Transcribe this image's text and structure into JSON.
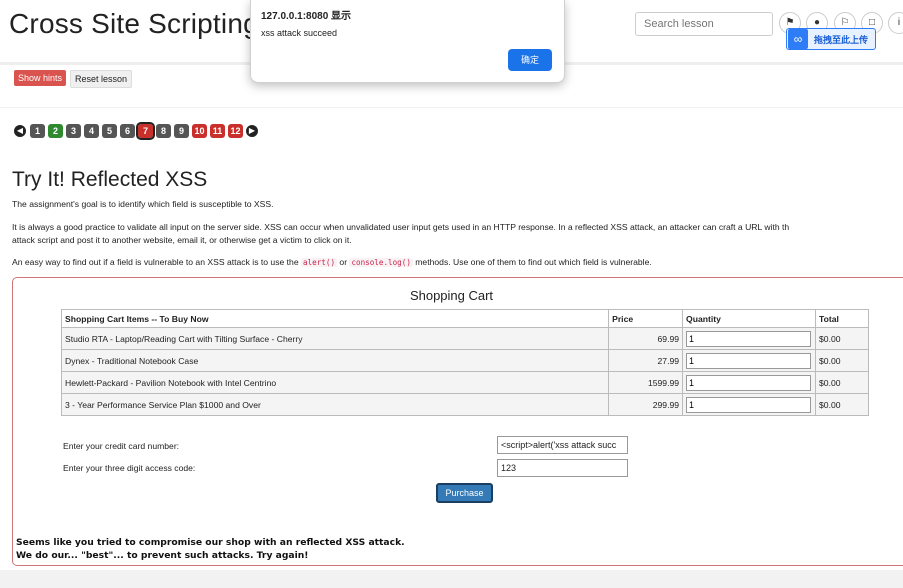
{
  "header": {
    "title": "Cross Site Scripting",
    "search_placeholder": "Search lesson",
    "upload_label": "拖拽至此上传"
  },
  "alert": {
    "title": "127.0.0.1:8080 显示",
    "message": "xss attack succeed",
    "ok_label": "确定"
  },
  "toolbar": {
    "hints_label": "Show hints",
    "reset_label": "Reset lesson"
  },
  "pagination": {
    "pages": [
      "1",
      "2",
      "3",
      "4",
      "5",
      "6",
      "7",
      "8",
      "9",
      "10",
      "11",
      "12"
    ],
    "current": "7"
  },
  "lesson": {
    "title": "Try It! Reflected XSS",
    "p1": "The assignment's goal is to identify which field is susceptible to XSS.",
    "p2a": "It is always a good practice to validate all input on the server side. XSS can occur when unvalidated user input gets used in an HTTP response. In a reflected XSS attack, an attacker can craft a URL with th",
    "p2b": "attack script and post it to another website, email it, or otherwise get a victim to click on it.",
    "p3_pre": "An easy way to find out if a field is vulnerable to an XSS attack is to use the ",
    "p3_code1": "alert()",
    "p3_mid": " or ",
    "p3_code2": "console.log()",
    "p3_post": " methods. Use one of them to find out which field is vulnerable."
  },
  "cart": {
    "title": "Shopping Cart",
    "headers": [
      "Shopping Cart Items -- To Buy Now",
      "Price",
      "Quantity",
      "Total"
    ],
    "rows": [
      {
        "item": "Studio RTA - Laptop/Reading Cart with Tilting Surface - Cherry",
        "price": "69.99",
        "qty": "1",
        "total": "$0.00"
      },
      {
        "item": "Dynex - Traditional Notebook Case",
        "price": "27.99",
        "qty": "1",
        "total": "$0.00"
      },
      {
        "item": "Hewlett-Packard - Pavilion Notebook with Intel Centrino",
        "price": "1599.99",
        "qty": "1",
        "total": "$0.00"
      },
      {
        "item": "3 - Year Performance Service Plan $1000 and Over",
        "price": "299.99",
        "qty": "1",
        "total": "$0.00"
      }
    ]
  },
  "form": {
    "card_label": "Enter your credit card number:",
    "card_value": "<script>alert('xss attack succ",
    "code_label": "Enter your three digit access code:",
    "code_value": "123",
    "purchase_label": "Purchase"
  },
  "feedback": {
    "line1": "Seems like you tried to compromise our shop with an reflected XSS attack.",
    "line2": "We do our... \"best\"... to prevent such attacks. Try again!"
  }
}
